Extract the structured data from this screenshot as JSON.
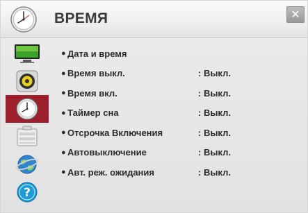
{
  "header": {
    "title": "ВРЕМЯ",
    "close_symbol": "✕"
  },
  "sidebar": {
    "items": [
      {
        "icon": "picture-icon",
        "active": false
      },
      {
        "icon": "audio-icon",
        "active": false
      },
      {
        "icon": "clock-icon",
        "active": true
      },
      {
        "icon": "options-icon",
        "active": false
      },
      {
        "icon": "network-icon",
        "active": false
      },
      {
        "icon": "help-icon",
        "active": false,
        "glyph": "?"
      }
    ]
  },
  "menu": {
    "bullet": "●",
    "rows": [
      {
        "label": "Дата и время",
        "value": ""
      },
      {
        "label": "Время выкл.",
        "value": ": Выкл."
      },
      {
        "label": "Время вкл.",
        "value": ": Выкл."
      },
      {
        "label": "Таймер сна",
        "value": ": Выкл."
      },
      {
        "label": "Отсрочка Включения",
        "value": ": Выкл."
      },
      {
        "label": "Автовыключение",
        "value": ": Выкл."
      },
      {
        "label": "Авт. реж. ожидания",
        "value": ": Выкл."
      }
    ]
  },
  "colors": {
    "active_item": "#9c1f2b",
    "text": "#2b2b2b",
    "title": "#3b3b3b"
  }
}
